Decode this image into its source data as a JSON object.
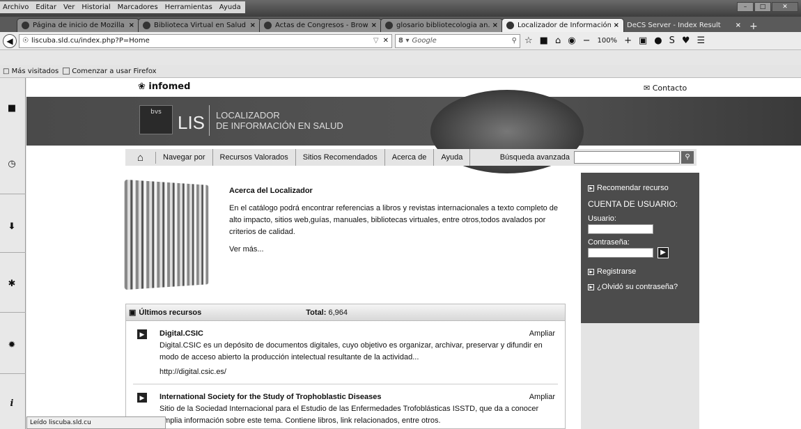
{
  "menu": [
    "Archivo",
    "Editar",
    "Ver",
    "Historial",
    "Marcadores",
    "Herramientas",
    "Ayuda"
  ],
  "tabs": [
    {
      "label": "Página de inicio de Mozilla ...",
      "active": false
    },
    {
      "label": "Biblioteca Virtual en Salud ...",
      "active": false
    },
    {
      "label": "Actas de Congresos - Brow...",
      "active": false
    },
    {
      "label": "glosario bibliotecologia an...",
      "active": false
    },
    {
      "label": "Localizador de Información...",
      "active": true
    },
    {
      "label": "DeCS Server - Index Result",
      "active": false
    }
  ],
  "nav": {
    "url": "liscuba.sld.cu/index.php?P=Home",
    "search_engine": "Google",
    "zoom": "100%"
  },
  "bookmarks": {
    "most_visited": "Más visitados",
    "getting_started": "Comenzar a usar Firefox"
  },
  "site": {
    "infomed": "infomed",
    "contact": "Contacto",
    "lis": "LIS",
    "bvs_text": "bvs",
    "loc_line1": "LOCALIZADOR",
    "loc_line2": "DE INFORMACIÓN EN SALUD",
    "nav_items": [
      "Navegar por",
      "Recursos Valorados",
      "Sitios Recomendados",
      "Acerca de",
      "Ayuda"
    ],
    "advanced_search": "Búsqueda avanzada"
  },
  "about": {
    "title": "Acerca del Localizador",
    "body": "En el catálogo podrá encontrar referencias a libros y revistas internacionales a texto completo de alto impacto, sitios web,guías, manuales, bibliotecas virtuales, entre otros,todos avalados por criterios de calidad.",
    "more": "Ver más..."
  },
  "account": {
    "recommend": "Recomendar recurso",
    "title": "CUENTA DE USUARIO:",
    "user_label": "Usuario:",
    "password_label": "Contraseña:",
    "register": "Registrarse",
    "forgot": "¿Olvidó su contraseña?"
  },
  "recent": {
    "title": "Últimos recursos",
    "total_label": "Total:",
    "total_value": "6,964",
    "items": [
      {
        "title": "Digital.CSIC",
        "desc": "Digital.CSIC es un depósito de documentos digitales, cuyo objetivo es organizar, archivar, preservar y difundir en modo de acceso abierto la producción intelectual resultante de la actividad...",
        "url": "http://digital.csic.es/",
        "action": "Ampliar"
      },
      {
        "title": "International Society for the Study of Trophoblastic Diseases",
        "desc": "Sitio de la Sociedad Internacional para el Estudio de las Enfermedades Trofoblásticas ISSTD, que da a conocer amplia información sobre este tema. Contiene libros, link relacionados, entre otros.",
        "url": "",
        "action": "Ampliar"
      }
    ]
  },
  "status": "Leído liscuba.sld.cu"
}
